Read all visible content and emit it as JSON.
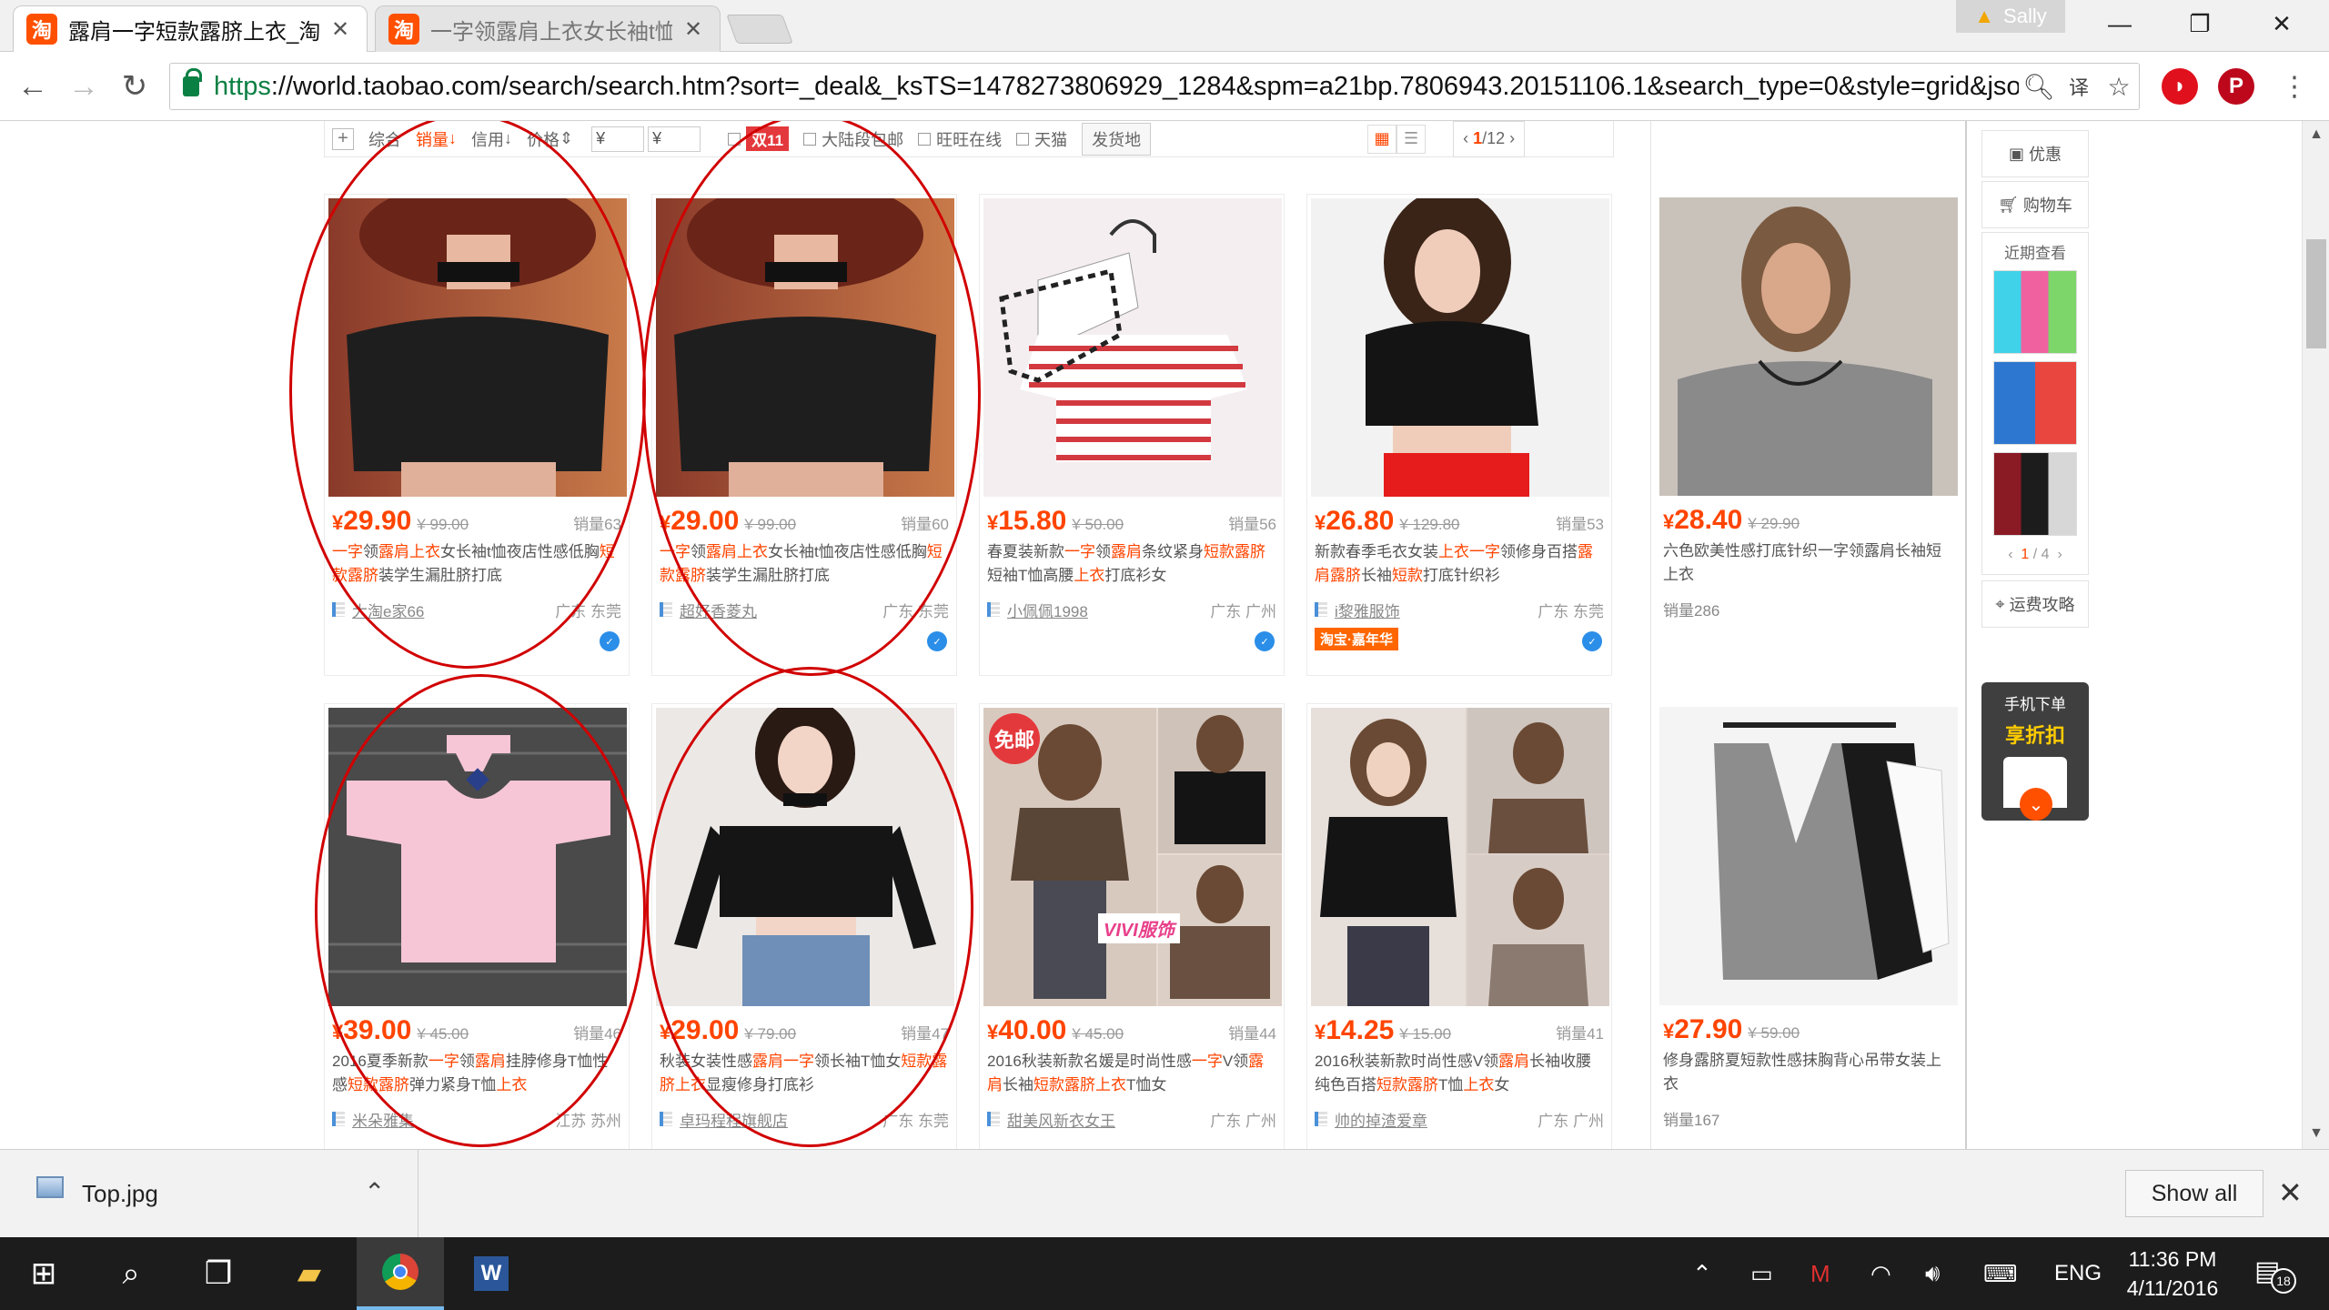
{
  "browser": {
    "tabs": [
      {
        "favicon": "淘",
        "title": "露肩一字短款露脐上衣_淘",
        "active": true
      },
      {
        "favicon": "淘",
        "title": "一字领露肩上衣女长袖t恤",
        "active": false
      }
    ],
    "profile_name": "Sally",
    "url_https": "https",
    "url_rest": "://world.taobao.com/search/search.htm?sort=_deal&_ksTS=1478273806929_1284&spm=a21bp.7806943.20151106.1&search_type=0&style=grid&json=on"
  },
  "filter_bar": {
    "sort_general": "综合",
    "sort_sales": "销量",
    "sort_credit": "信用",
    "sort_price": "价格",
    "price_min": "¥",
    "price_max": "¥",
    "double11_badge": "双11",
    "opt_mainland_free": "大陆段包邮",
    "opt_wangwang": "旺旺在线",
    "opt_tmall": "天猫",
    "ship_from": "发货地",
    "page_current": "1",
    "page_total": "/12"
  },
  "products": [
    {
      "price": "29.90",
      "old_price": "¥ 99.00",
      "sales": "销量63",
      "title_a": "一字",
      "title_b": "领",
      "title_c": "露肩上衣",
      "title_d": "女长袖t恤夜店性感低胸",
      "title_e": "短款露脐",
      "title_f": "装学生漏肚脐打底",
      "shop": "大淘e家66",
      "location": "广东 东莞"
    },
    {
      "price": "29.00",
      "old_price": "¥ 99.00",
      "sales": "销量60",
      "title_a": "一字",
      "title_b": "领",
      "title_c": "露肩上衣",
      "title_d": "女长袖t恤夜店性感低胸",
      "title_e": "短款露脐",
      "title_f": "装学生漏肚脐打底",
      "shop": "超好香菱丸",
      "location": "广东 东莞"
    },
    {
      "price": "15.80",
      "old_price": "¥ 50.00",
      "sales": "销量56",
      "title_a": "春夏装新款",
      "title_b": "一字",
      "title_c": "领",
      "title_d": "露肩",
      "title_e": "条纹紧身",
      "title_f": "短款露脐",
      "title_g": "短袖T恤高腰",
      "title_h": "上衣",
      "title_i": "打底衫女",
      "shop": "小佩佩1998",
      "location": "广东 广州"
    },
    {
      "price": "26.80",
      "old_price": "¥ 129.80",
      "sales": "销量53",
      "title_a": "新款春季毛衣女装",
      "title_b": "上衣",
      "title_c": "一字",
      "title_d": "领修身百搭",
      "title_e": "露肩露脐",
      "title_f": "长袖",
      "title_g": "短款",
      "title_h": "打底针织衫",
      "shop": "i黎雅服饰",
      "location": "广东 东莞",
      "tag": "淘宝·嘉年华"
    },
    {
      "price": "28.40",
      "old_price": "¥ 29.90",
      "title": "六色欧美性感打底针织一字领露肩长袖短上衣",
      "sales_row": "销量286"
    },
    {
      "price": "39.00",
      "old_price": "¥ 45.00",
      "sales": "销量46",
      "title_a": "2016夏季新款",
      "title_b": "一字",
      "title_c": "领",
      "title_d": "露肩",
      "title_e": "挂脖修身T恤性感",
      "title_f": "短款露脐",
      "title_g": "弹力紧身T恤",
      "title_h": "上衣",
      "shop": "米朵雅集",
      "location": "江苏 苏州"
    },
    {
      "price": "29.00",
      "old_price": "¥ 79.00",
      "sales": "销量47",
      "title_a": "秋装女装性感",
      "title_b": "露肩",
      "title_c": "一字",
      "title_d": "领长袖T恤女",
      "title_e": "短款露脐",
      "title_f": "上衣",
      "title_g": "显瘦修身打底衫",
      "shop": "卓玛程程旗舰店",
      "location": "广东 东莞"
    },
    {
      "price": "40.00",
      "old_price": "¥ 45.00",
      "sales": "销量44",
      "title_a": "2016秋装新款名媛是时尚性感",
      "title_b": "一字",
      "title_c": "V领",
      "title_d": "露肩",
      "title_e": "长袖",
      "title_f": "短款露脐上衣",
      "title_g": "T恤女",
      "shop": "甜美风新衣女王",
      "location": "广东 广州",
      "freeship": "免邮",
      "watermark": "VIVI服饰"
    },
    {
      "price": "14.25",
      "old_price": "¥ 15.00",
      "sales": "销量41",
      "title_a": "2016秋装新款时尚性感V领",
      "title_b": "露肩",
      "title_c": "长袖收腰纯色百搭",
      "title_d": "短款露脐",
      "title_e": "T恤",
      "title_f": "上衣",
      "title_g": "女",
      "shop": "帅的掉渣爱章",
      "location": "广东 广州"
    },
    {
      "price": "27.90",
      "old_price": "¥ 59.00",
      "title": "修身露脐夏短款性感抹胸背心吊带女装上衣",
      "sales_row": "销量167"
    }
  ],
  "right_panel": {
    "coupon": "优惠",
    "cart": "购物车",
    "recent": "近期查看",
    "pager_current": "1",
    "pager_total": " / 4",
    "shipping": "运费攻略",
    "app_line1": "手机下单",
    "app_line2": "享折扣"
  },
  "download_bar": {
    "file_name": "Top.jpg",
    "show_all": "Show all"
  },
  "taskbar": {
    "language": "ENG",
    "time": "11:36 PM",
    "date": "4/11/2016",
    "notifications": "18"
  },
  "colors": {
    "accent": "#ff4400",
    "annotation_ring": "#d10000",
    "taskbar": "#1c1c1c"
  }
}
